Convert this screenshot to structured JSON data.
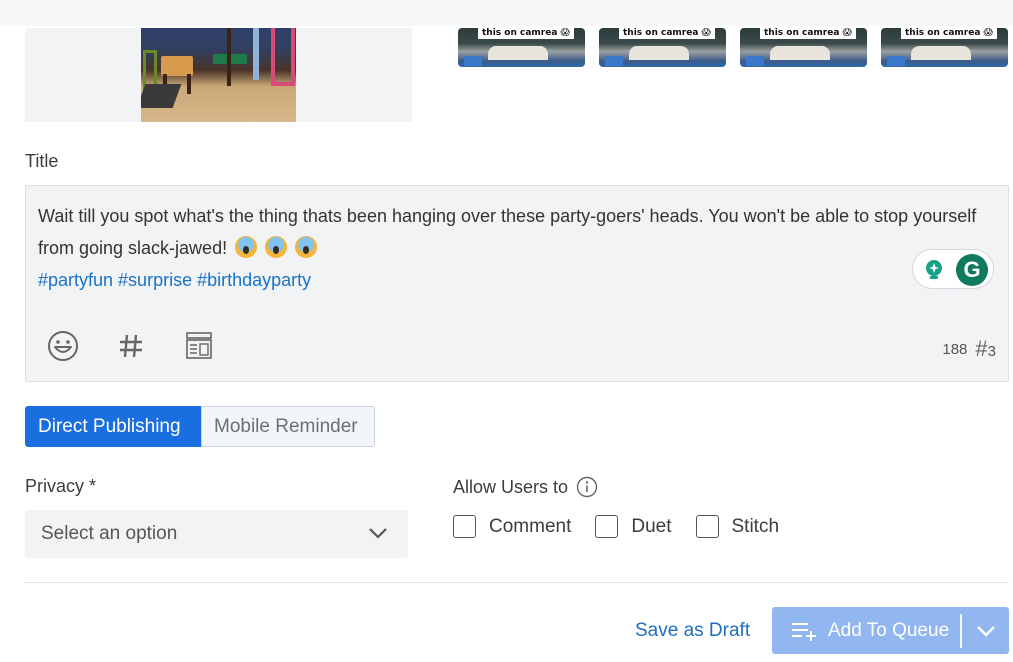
{
  "media": {
    "thumbnails": [
      {
        "caption": "this on camrea 😱"
      },
      {
        "caption": "this on camrea 😱"
      },
      {
        "caption": "this on camrea 😱"
      },
      {
        "caption": "this on camrea 😱"
      }
    ]
  },
  "title_field": {
    "label": "Title",
    "text_line": "Wait till you spot what's the thing thats been hanging over these party-goers' heads. You won't be able to stop yourself from going slack-jawed!",
    "emojis": [
      "😱",
      "😱",
      "😱"
    ],
    "hashtags": "#partyfun #surprise #birthdayparty",
    "char_count": "188",
    "hashtag_count": "3",
    "hashtag_symbol": "#",
    "grammarly_letter": "G",
    "toolbar_icons": [
      "emoji-icon",
      "hashtag-icon",
      "template-icon"
    ]
  },
  "publishing_mode": {
    "options": [
      "Direct Publishing",
      "Mobile Reminder"
    ],
    "selected": "Direct Publishing"
  },
  "privacy": {
    "label": "Privacy *",
    "placeholder": "Select an option"
  },
  "allow_users": {
    "label": "Allow Users to",
    "options": [
      {
        "label": "Comment",
        "checked": false
      },
      {
        "label": "Duet",
        "checked": false
      },
      {
        "label": "Stitch",
        "checked": false
      }
    ]
  },
  "actions": {
    "save_draft": "Save as Draft",
    "add_to_queue": "Add To Queue"
  },
  "colors": {
    "primary": "#1a6fe0",
    "primary_disabled": "#91b6f0",
    "link": "#1f6ec0",
    "hashtag": "#1a73c8",
    "grammarly": "#0f7a5e"
  }
}
